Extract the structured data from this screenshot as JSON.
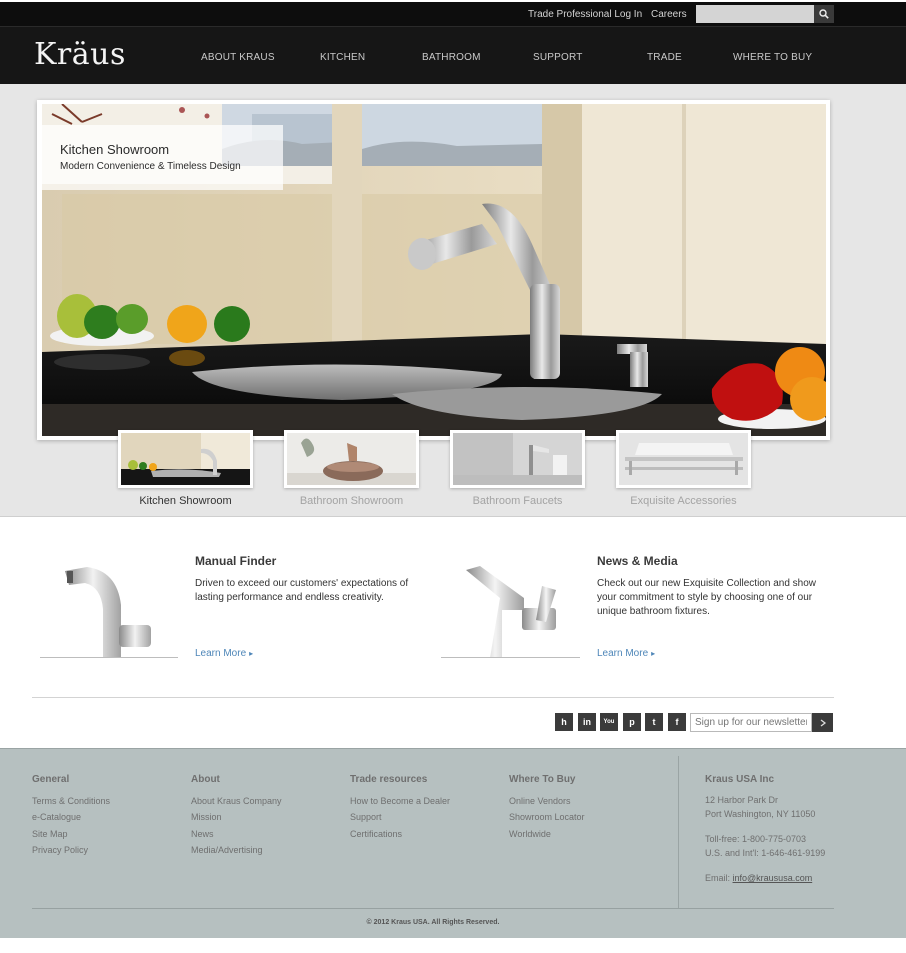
{
  "topbar": {
    "trade_login": "Trade Professional Log In",
    "careers": "Careers",
    "search_placeholder": ""
  },
  "brand": {
    "logo": "Kräus"
  },
  "nav": [
    "ABOUT KRAUS",
    "KITCHEN",
    "BATHROOM",
    "SUPPORT",
    "TRADE",
    "WHERE TO BUY"
  ],
  "hero": {
    "title": "Kitchen Showroom",
    "subtitle": "Modern Convenience & Timeless Design",
    "thumbs": [
      {
        "label": "Kitchen Showroom",
        "active": true
      },
      {
        "label": "Bathroom Showroom",
        "active": false
      },
      {
        "label": "Bathroom Faucets",
        "active": false
      },
      {
        "label": "Exquisite Accessories",
        "active": false
      }
    ]
  },
  "features": [
    {
      "title": "Manual Finder",
      "text": "Driven to exceed our customers' expectations of lasting performance and endless creativity.",
      "link": "Learn More"
    },
    {
      "title": "News & Media",
      "text": "Check out our new Exquisite Collection and show your commitment to style by choosing one of our unique bathroom fixtures.",
      "link": "Learn More"
    }
  ],
  "social": {
    "icons": [
      "houzz-icon",
      "linkedin-icon",
      "youtube-icon",
      "pinterest-icon",
      "tumblr-icon",
      "facebook-icon"
    ],
    "newsletter_placeholder": "Sign up for our newsletter"
  },
  "footer": {
    "general": {
      "title": "General",
      "links": [
        "Terms & Conditions",
        "e-Catalogue",
        "Site Map",
        "Privacy Policy"
      ]
    },
    "about": {
      "title": "About",
      "links": [
        "About Kraus Company",
        "Mission",
        "News",
        "Media/Advertising"
      ]
    },
    "trade": {
      "title": "Trade resources",
      "links": [
        "How to Become a Dealer",
        "Support",
        "Certifications"
      ]
    },
    "where": {
      "title": "Where To Buy",
      "links": [
        "Online Vendors",
        "Showroom Locator",
        "Worldwide"
      ]
    },
    "company": {
      "title": "Kraus USA Inc",
      "address1": "12 Harbor Park Dr",
      "address2": "Port Washington, NY 11050",
      "tollfree": "Toll-free: 1-800-775-0703",
      "intl": "U.S. and Int'l: 1-646-461-9199",
      "email_label": "Email:",
      "email": "info@kraususa.com"
    },
    "copyright": "© 2012 Kraus USA. All Rights Reserved."
  },
  "colors": {
    "topbar": "#0d0d0d",
    "nav": "#161616",
    "link_blue": "#4e86b8",
    "footer_bg": "#b6c0c0"
  }
}
